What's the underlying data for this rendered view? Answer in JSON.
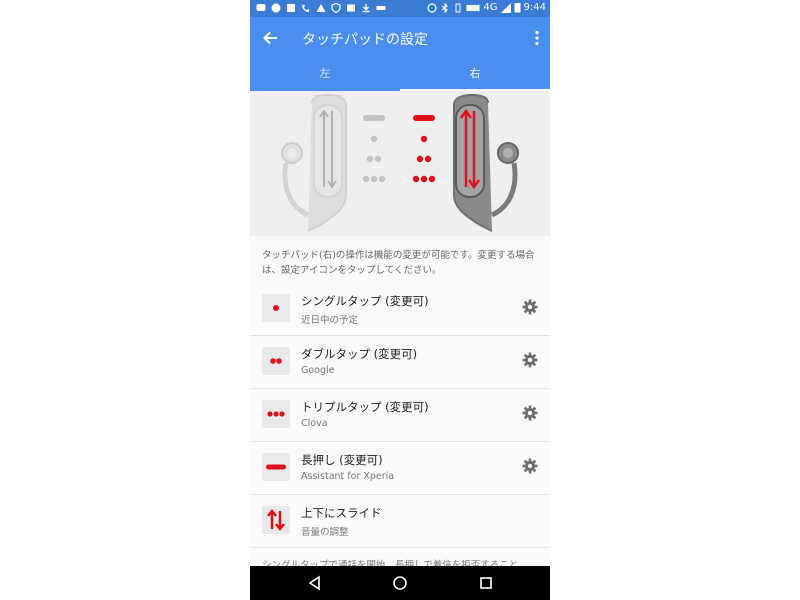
{
  "status_bar": {
    "network": "4G",
    "time": "9:44"
  },
  "app_bar": {
    "title": "タッチパッドの設定"
  },
  "tabs": [
    {
      "label": "左",
      "active": false
    },
    {
      "label": "右",
      "active": true
    }
  ],
  "description": "タッチパッド(右)の操作は機能の変更が可能です。変更する場合は、設定アイコンをタップしてください。",
  "gestures": [
    {
      "name": "シングルタップ (変更可)",
      "value": "近日中の予定",
      "icon": "single-dot-icon",
      "configurable": true
    },
    {
      "name": "ダブルタップ (変更可)",
      "value": "Google",
      "icon": "double-dot-icon",
      "configurable": true
    },
    {
      "name": "トリプルタップ (変更可)",
      "value": "Clova",
      "icon": "triple-dot-icon",
      "configurable": true
    },
    {
      "name": "長押し (変更可)",
      "value": "Assistant for Xperia",
      "icon": "long-press-icon",
      "configurable": true
    },
    {
      "name": "上下にスライド",
      "value": "音量の調整",
      "icon": "slide-up-down-icon",
      "configurable": false
    }
  ],
  "footer_text": "シングルタップで通話を開始、長押しで着信を拒否すること",
  "colors": {
    "primary": "#4a8ef0",
    "accent_red": "#e0101a"
  }
}
